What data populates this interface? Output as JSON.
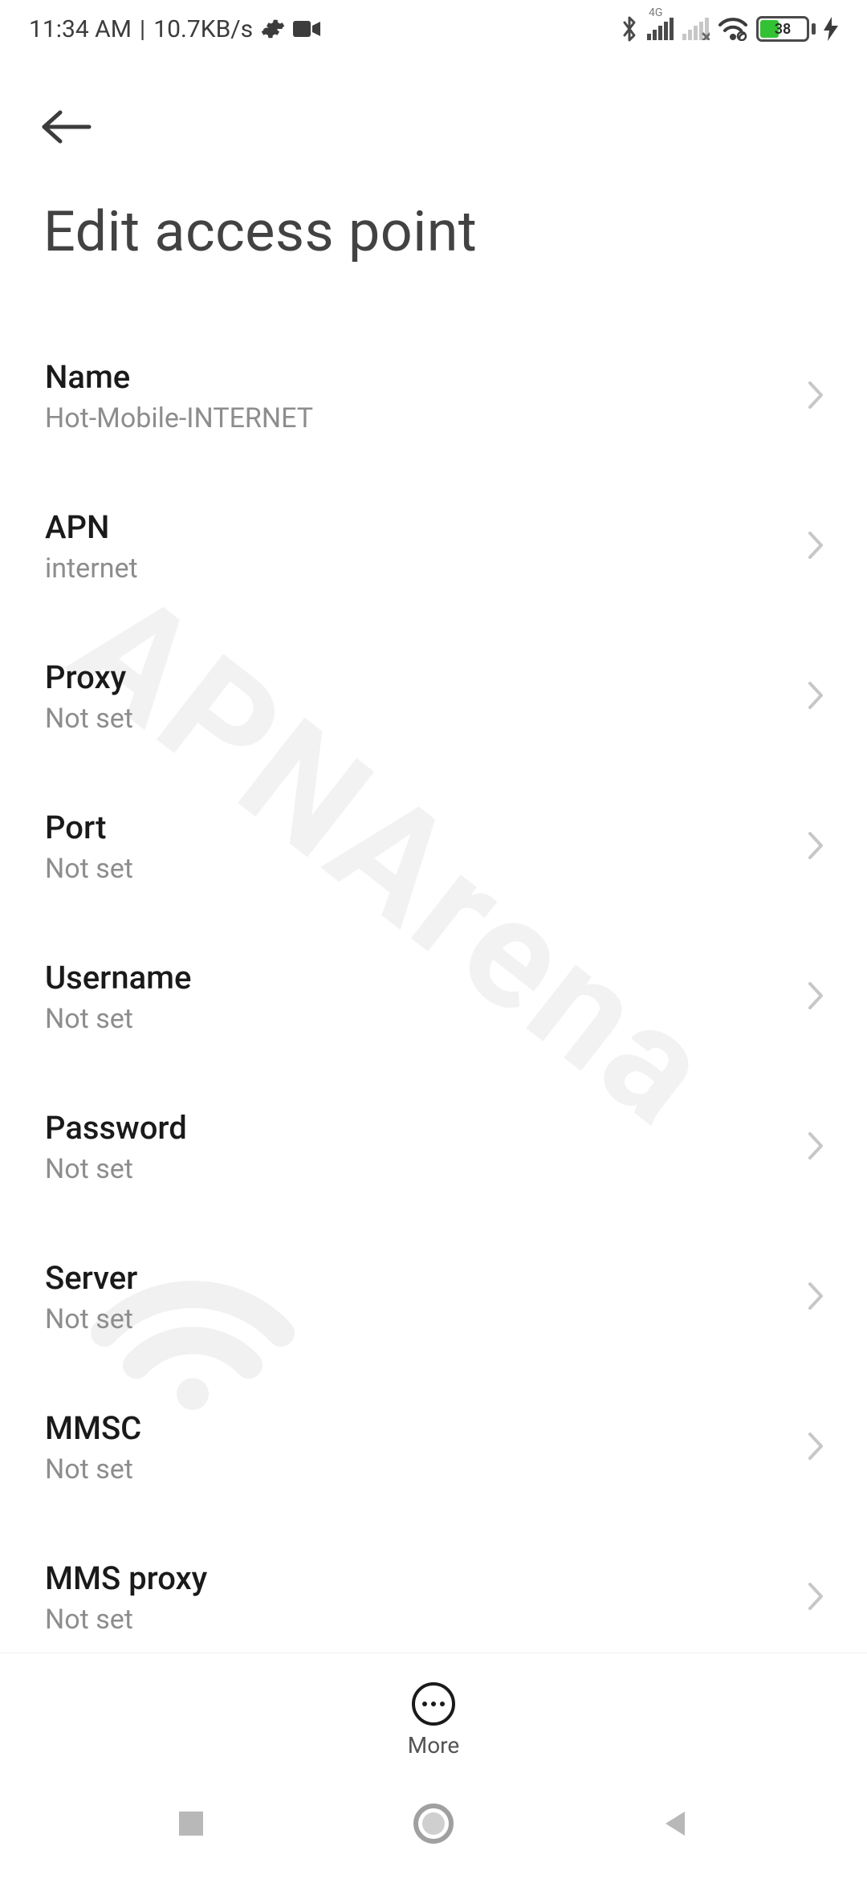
{
  "statusbar": {
    "time": "11:34 AM",
    "sep": "|",
    "speed": "10.7KB/s",
    "network_label": "4G",
    "battery_pct": "38"
  },
  "header": {
    "title": "Edit access point"
  },
  "rows": [
    {
      "label": "Name",
      "value": "Hot-Mobile-INTERNET"
    },
    {
      "label": "APN",
      "value": "internet"
    },
    {
      "label": "Proxy",
      "value": "Not set"
    },
    {
      "label": "Port",
      "value": "Not set"
    },
    {
      "label": "Username",
      "value": "Not set"
    },
    {
      "label": "Password",
      "value": "Not set"
    },
    {
      "label": "Server",
      "value": "Not set"
    },
    {
      "label": "MMSC",
      "value": "Not set"
    },
    {
      "label": "MMS proxy",
      "value": "Not set"
    }
  ],
  "more": {
    "label": "More"
  },
  "watermark": {
    "text": "APNArena"
  }
}
